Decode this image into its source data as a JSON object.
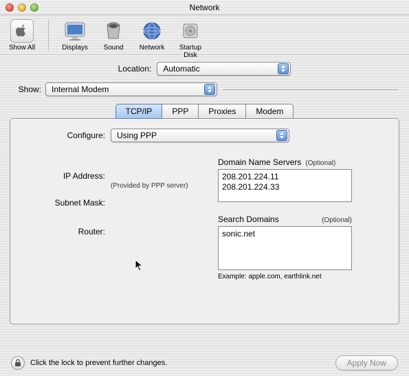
{
  "window": {
    "title": "Network"
  },
  "toolbar": {
    "show_all": "Show All",
    "displays": "Displays",
    "sound": "Sound",
    "network": "Network",
    "startup_disk": "Startup Disk"
  },
  "location": {
    "label": "Location:",
    "value": "Automatic"
  },
  "show": {
    "label": "Show:",
    "value": "Internal Modem"
  },
  "tabs": {
    "tcpip": "TCP/IP",
    "ppp": "PPP",
    "proxies": "Proxies",
    "modem": "Modem"
  },
  "configure": {
    "label": "Configure:",
    "value": "Using PPP"
  },
  "fields": {
    "ip_label": "IP Address:",
    "ip_note": "(Provided by PPP server)",
    "subnet_label": "Subnet Mask:",
    "router_label": "Router:"
  },
  "dns": {
    "title": "Domain Name Servers",
    "optional": "(Optional)",
    "value": "208.201.224.11\n208.201.224.33"
  },
  "search": {
    "title": "Search Domains",
    "optional": "(Optional)",
    "value": "sonic.net",
    "example": "Example: apple.com, earthlink.net"
  },
  "footer": {
    "lock_text": "Click the lock to prevent further changes.",
    "apply": "Apply Now"
  }
}
